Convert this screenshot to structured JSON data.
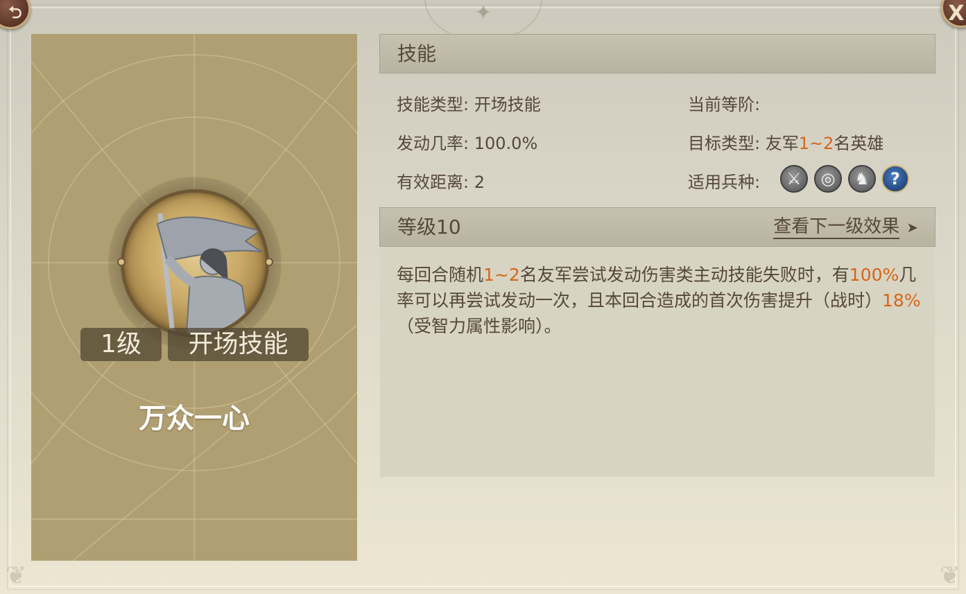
{
  "nav": {
    "back_icon": "back-arrow-icon",
    "close_label": "X"
  },
  "card": {
    "level_tag": "1级",
    "type_tag": "开场技能",
    "name": "万众一心",
    "emblem_icon": "banner-warrior-icon"
  },
  "skill_section": {
    "title": "技能"
  },
  "info": {
    "skill_type_label": "技能类型:",
    "skill_type_value": "开场技能",
    "current_rank_label": "当前等阶:",
    "current_rank_value": "",
    "trigger_rate_label": "发动几率:",
    "trigger_rate_value": "100.0%",
    "target_type_label": "目标类型:",
    "target_type_prefix": "友军",
    "target_type_highlight": "1~2",
    "target_type_suffix": "名英雄",
    "range_label": "有效距离:",
    "range_value": "2",
    "troop_label": "适用兵种:",
    "troop_icons": [
      "sword-icon",
      "target-icon",
      "horse-icon",
      "question-icon"
    ],
    "question_mark": "?"
  },
  "level_section": {
    "title": "等级10",
    "next_link": "查看下一级效果",
    "next_arrow": "➤"
  },
  "description": {
    "p1": "每回合随机",
    "h1": "1~2",
    "p2": "名友军尝试发动伤害类主动技能失败时，有",
    "h2": "100%",
    "p3": "几率可以再尝试发动一次，且本回合造成的首次伤害提升（战时）",
    "h3": "18%",
    "p4": "（受智力属性影响）。"
  },
  "colors": {
    "highlight": "#d5651a",
    "text": "#55483a",
    "card_bg": "#b09f72",
    "header_bg": "#c0bba9"
  }
}
